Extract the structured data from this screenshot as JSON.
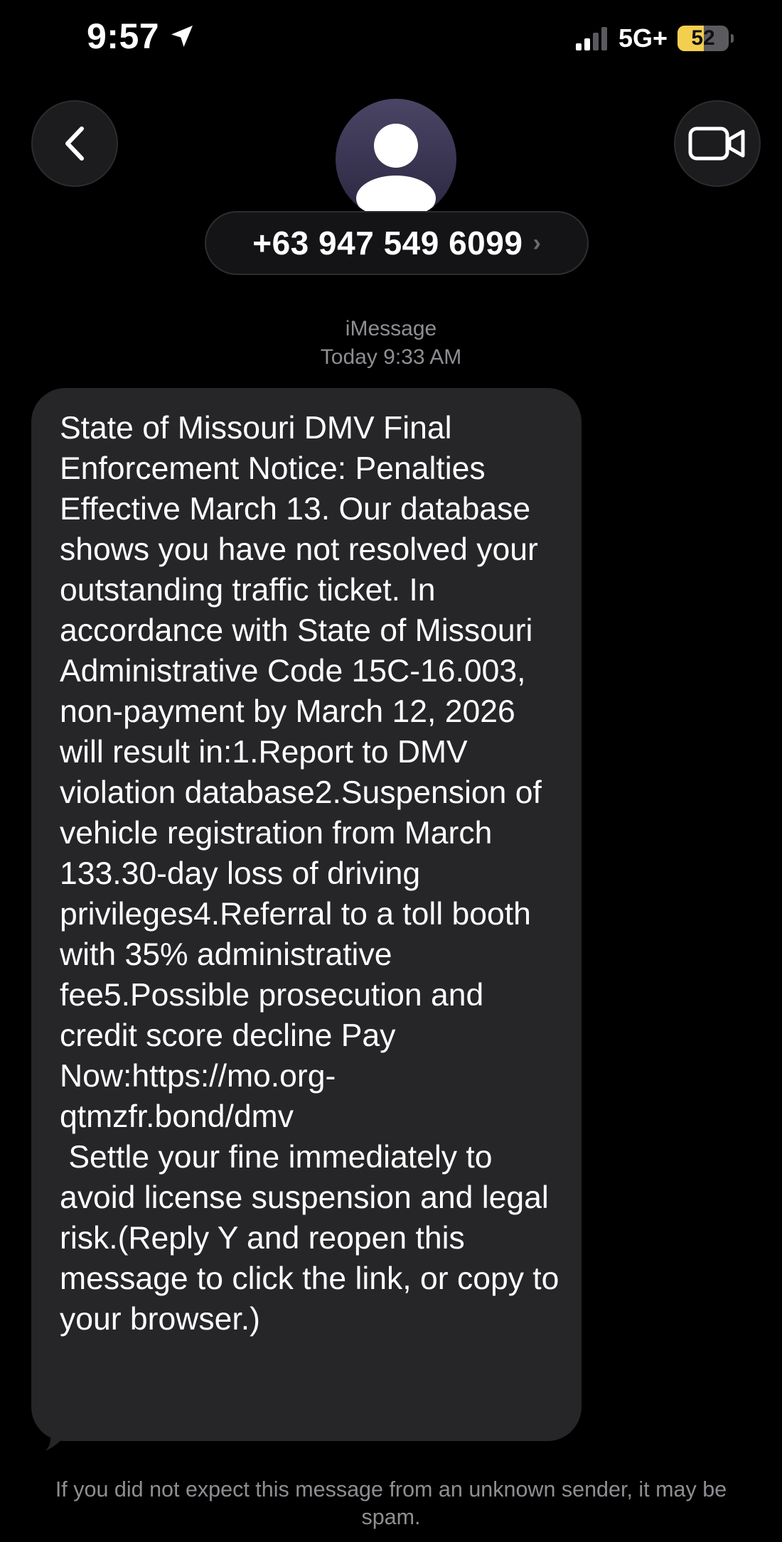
{
  "status_bar": {
    "time": "9:57",
    "location_icon": "location-arrow-icon",
    "signal_icon": "cellular-signal-icon",
    "signal_bars_active": 2,
    "signal_bars_total": 4,
    "network": "5G+",
    "battery_level": "52",
    "battery_fill_fraction": 0.52,
    "battery_color": "#f4cf4f"
  },
  "header": {
    "back_icon": "chevron-left-icon",
    "avatar_icon": "person-silhouette-icon",
    "contact_name": "+63 947 549 6099",
    "contact_chevron": "›",
    "video_icon": "video-camera-icon"
  },
  "conversation": {
    "service": "iMessage",
    "timestamp": "Today 9:33 AM",
    "messages": [
      {
        "direction": "incoming",
        "text": "State of Missouri DMV Final Enforcement Notice: Penalties Effective March 13. Our database shows you have not resolved your outstanding traffic ticket. In accordance with State of Missouri Administrative Code 15C-16.003, non-payment by March 12, 2026 will result in:1.Report to DMV violation database2.Suspension of vehicle registration from March 133.30-day loss of driving privileges4.Referral to a toll booth with 35% administrative fee5.Possible prosecution and credit score decline Pay Now:https://mo.org-qtmzfr.bond/dmv\n Settle your fine immediately to avoid license suspension and legal risk.(Reply Y and reopen this message to click the link, or copy to your browser.)"
      }
    ],
    "spam_notice": "If you did not expect this message from an unknown sender, it may be spam."
  },
  "colors": {
    "background": "#000000",
    "bubble": "#262628",
    "secondary_text": "#8e8e93",
    "button_bg": "#1c1c1e"
  }
}
